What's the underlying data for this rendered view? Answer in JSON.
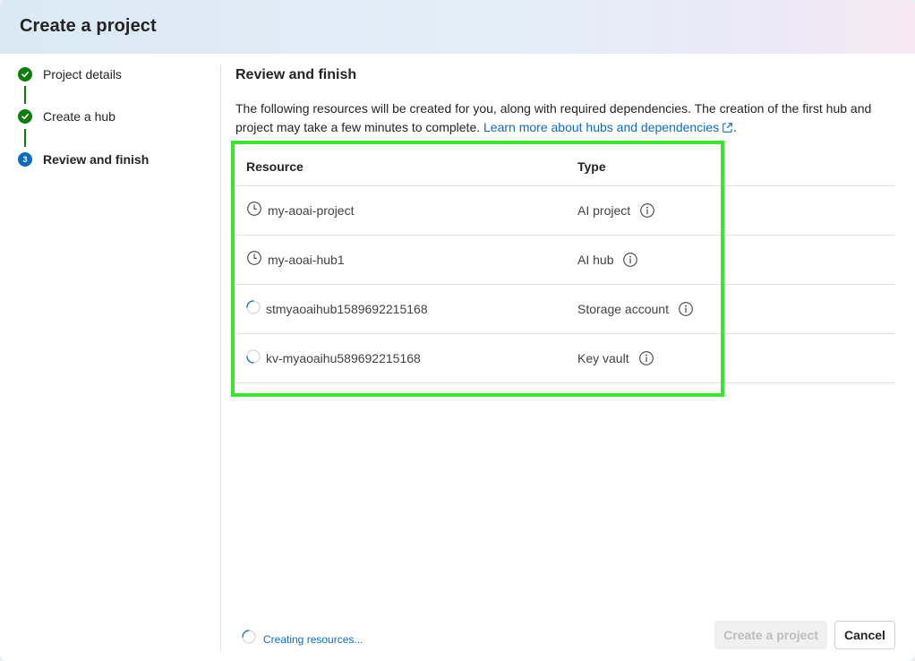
{
  "dialog": {
    "title": "Create a project"
  },
  "steps": [
    {
      "number": "1",
      "label": "Project details",
      "state": "done"
    },
    {
      "number": "2",
      "label": "Create a hub",
      "state": "done"
    },
    {
      "number": "3",
      "label": "Review and finish",
      "state": "current"
    }
  ],
  "main": {
    "title": "Review and finish",
    "description": "The following resources will be created for you, along with required dependencies. The creation of the first hub and project may take a few minutes to complete.",
    "learn_more_link": "Learn more about hubs and dependencies",
    "learn_more_suffix": "."
  },
  "table": {
    "columns": [
      "Resource",
      "Type"
    ],
    "rows": [
      {
        "resource": "my-aoai-project",
        "type": "AI project",
        "status_icon": "clock-icon"
      },
      {
        "resource": "my-aoai-hub1",
        "type": "AI hub",
        "status_icon": "clock-icon"
      },
      {
        "resource": "stmyaoaihub1589692215168",
        "type": "Storage account",
        "status_icon": "spinner-icon"
      },
      {
        "resource": "kv-myaoaihu589692215168",
        "type": "Key vault",
        "status_icon": "spinner-icon"
      }
    ]
  },
  "footer": {
    "status_text": "Creating resources...",
    "primary_button": "Create a project",
    "cancel_button": "Cancel"
  },
  "colors": {
    "accent": "#0f6cbd",
    "success": "#107c10",
    "highlight": "#3fe234"
  }
}
